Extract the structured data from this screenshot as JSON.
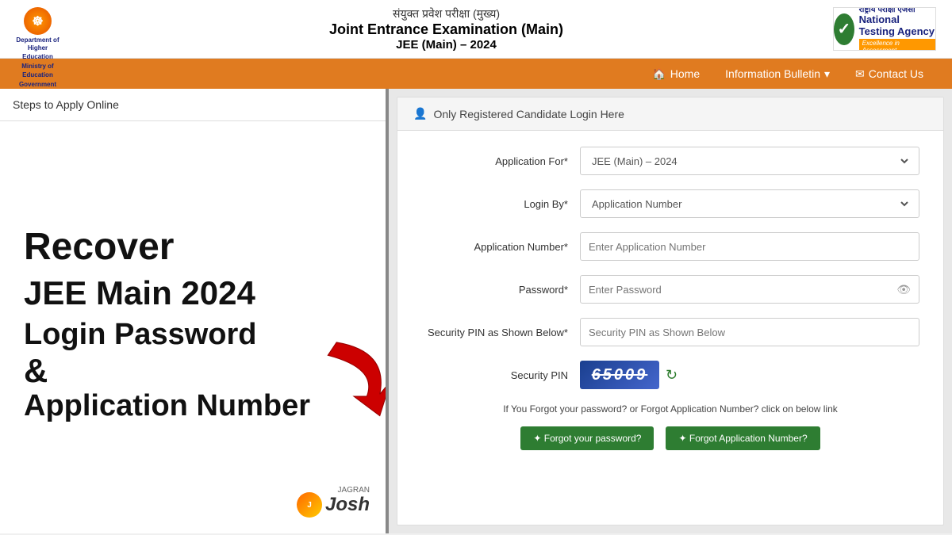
{
  "header": {
    "hindi_title": "संयुक्त प्रवेश परीक्षा (मुख्य)",
    "main_title": "Joint Entrance Examination (Main)",
    "sub_title": "JEE (Main) – 2024",
    "dept_line1": "Department of Higher Education",
    "dept_line2": "Ministry of Education",
    "dept_line3": "Government of India",
    "nta_hindi": "राष्ट्रीय परीक्षा एजेंसी",
    "nta_english": "National Testing Agency",
    "nta_tagline": "Excellence in Assessment"
  },
  "navbar": {
    "home_label": "Home",
    "info_bulletin_label": "Information Bulletin",
    "contact_label": "Contact Us"
  },
  "left_panel": {
    "steps_label": "Steps to Apply Online",
    "recover_line1": "Recover",
    "recover_line2": "JEE Main 2024",
    "recover_line3": "Login Password",
    "recover_line4": "&",
    "recover_line5": "Application Number",
    "jagran_label": "JAGRAN",
    "josh_label": "Josh"
  },
  "right_panel": {
    "header_label": "Only Registered Candidate Login Here",
    "app_for_label": "Application For*",
    "login_by_label": "Login By*",
    "app_number_label": "Application Number*",
    "password_label": "Password*",
    "security_pin_label": "Security PIN as Shown Below*",
    "security_pin_display_label": "Security PIN",
    "app_for_value": "JEE (Main) – 2024",
    "login_by_value": "Application Number",
    "app_number_placeholder": "Enter Application Number",
    "password_placeholder": "Enter Password",
    "security_pin_placeholder": "Security PIN as Shown Below",
    "captcha_value": "65009",
    "forgot_text": "If You Forgot your password? or Forgot Application Number? click on below link",
    "forgot_password_btn": "✦ Forgot your password?",
    "forgot_appnum_btn": "✦ Forgot Application Number?"
  }
}
